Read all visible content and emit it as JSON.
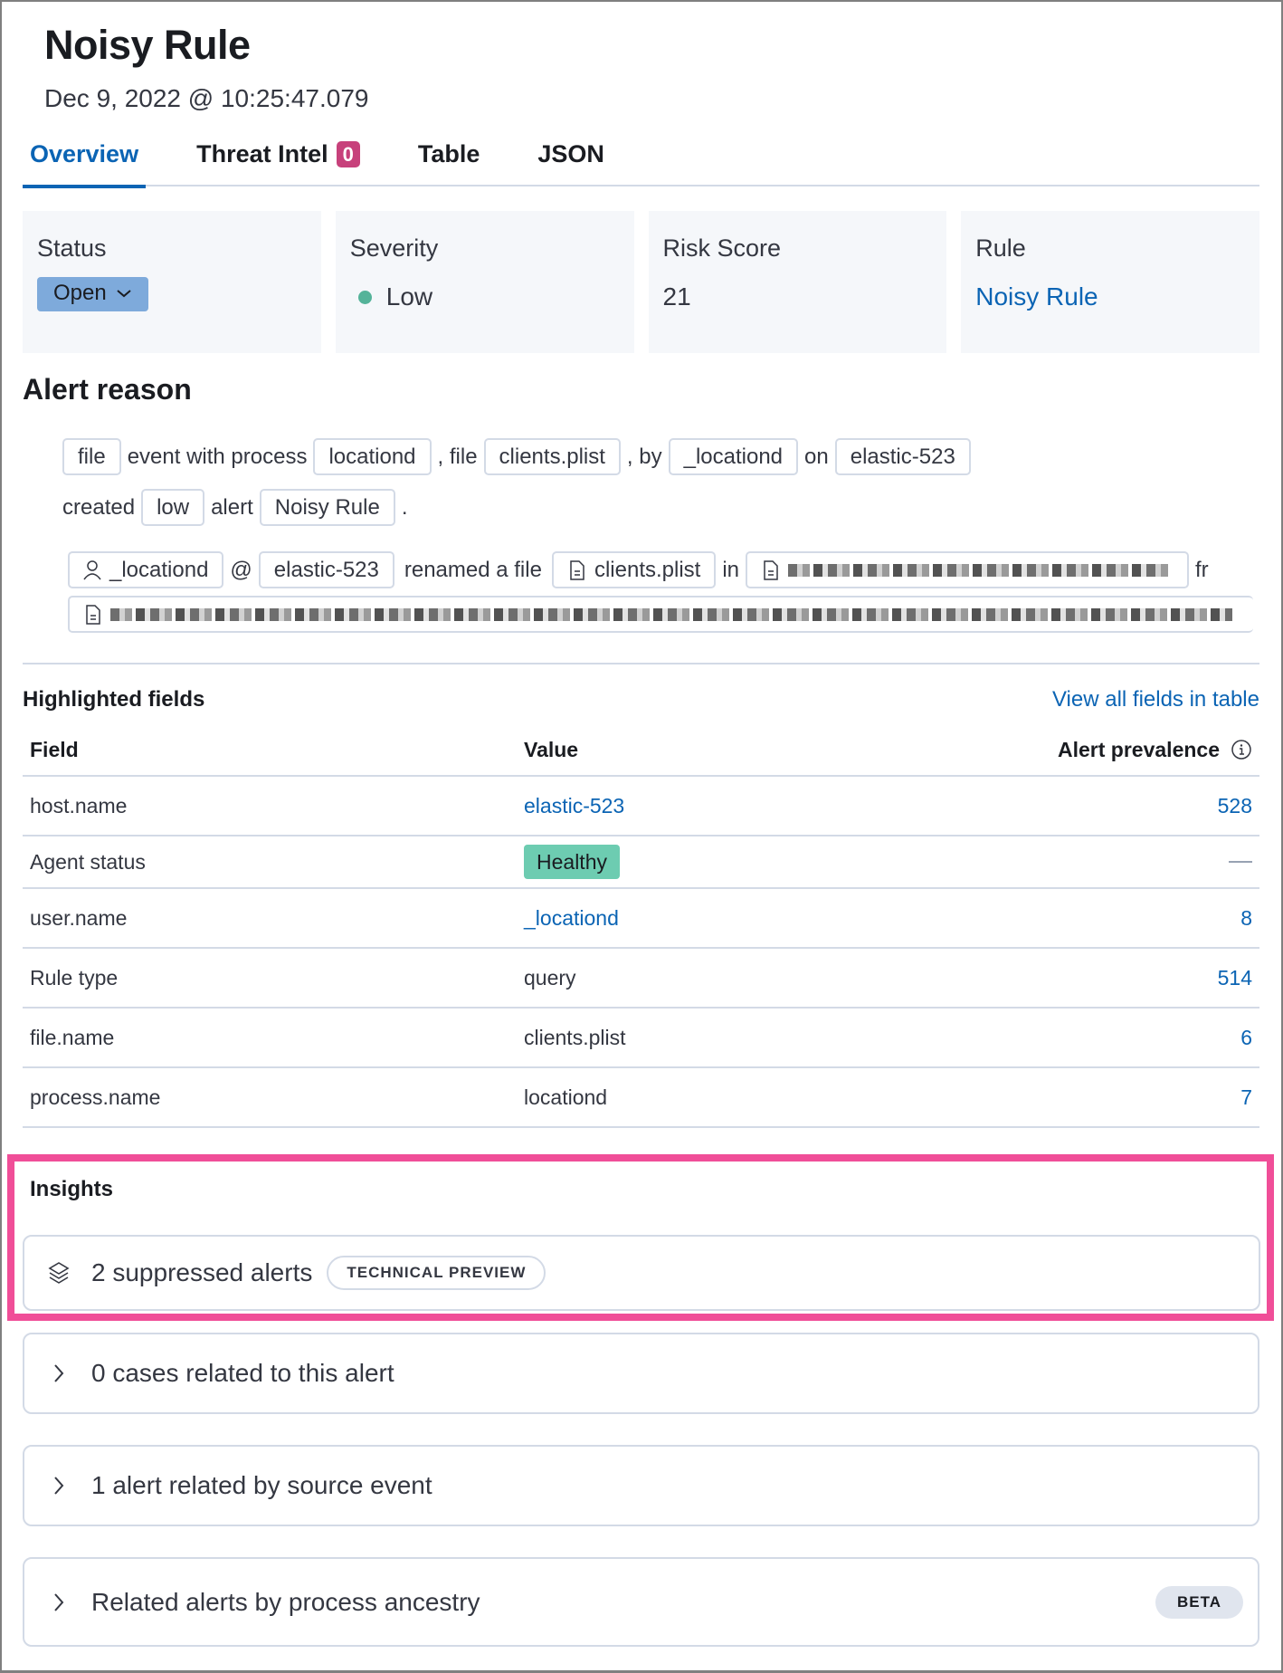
{
  "header": {
    "title": "Noisy Rule",
    "timestamp": "Dec 9, 2022 @ 10:25:47.079"
  },
  "tabs": [
    {
      "label": "Overview",
      "active": true
    },
    {
      "label": "Threat Intel",
      "badge": "0"
    },
    {
      "label": "Table"
    },
    {
      "label": "JSON"
    }
  ],
  "summary": {
    "status": {
      "label": "Status",
      "value": "Open"
    },
    "severity": {
      "label": "Severity",
      "value": "Low",
      "color": "#54b399"
    },
    "risk_score": {
      "label": "Risk Score",
      "value": "21"
    },
    "rule": {
      "label": "Rule",
      "value": "Noisy Rule"
    }
  },
  "alert_reason": {
    "heading": "Alert reason",
    "line1": {
      "chip_event": "file",
      "t1": "event with process",
      "chip_process": "locationd",
      "t2": ", file",
      "chip_file": "clients.plist",
      "t3": ", by",
      "chip_user": "_locationd",
      "t4": "on",
      "chip_host": "elastic-523"
    },
    "line2": {
      "t1": "created",
      "chip_severity": "low",
      "t2": "alert",
      "chip_rule": "Noisy Rule",
      "t3": "."
    },
    "process_row": {
      "user": "_locationd",
      "at": "@",
      "host": "elastic-523",
      "action": "renamed a file",
      "file": "clients.plist",
      "in": "in",
      "trailing": "fr"
    }
  },
  "highlighted_fields": {
    "title": "Highlighted fields",
    "view_all_link": "View all fields in table",
    "columns": [
      "Field",
      "Value",
      "Alert prevalence"
    ],
    "rows": [
      {
        "field": "host.name",
        "value": "elastic-523",
        "value_type": "link",
        "prevalence": "528"
      },
      {
        "field": "Agent status",
        "value": "Healthy",
        "value_type": "badge",
        "prevalence": "—"
      },
      {
        "field": "user.name",
        "value": "_locationd",
        "value_type": "link",
        "prevalence": "8"
      },
      {
        "field": "Rule type",
        "value": "query",
        "value_type": "text",
        "prevalence": "514"
      },
      {
        "field": "file.name",
        "value": "clients.plist",
        "value_type": "text",
        "prevalence": "6"
      },
      {
        "field": "process.name",
        "value": "locationd",
        "value_type": "text",
        "prevalence": "7"
      }
    ]
  },
  "insights": {
    "title": "Insights",
    "suppressed": {
      "label": "2 suppressed alerts",
      "badge": "TECHNICAL PREVIEW"
    },
    "accordions": [
      {
        "label": "0 cases related to this alert"
      },
      {
        "label": "1 alert related by source event"
      },
      {
        "label": "Related alerts by process ancestry",
        "badge": "BETA"
      }
    ],
    "highlight_color": "#f04e98"
  },
  "colors": {
    "accent": "#0b64b4",
    "threat_badge": "#c7417b",
    "status_button": "#7eaadb",
    "healthy_badge": "#6dccb1"
  }
}
